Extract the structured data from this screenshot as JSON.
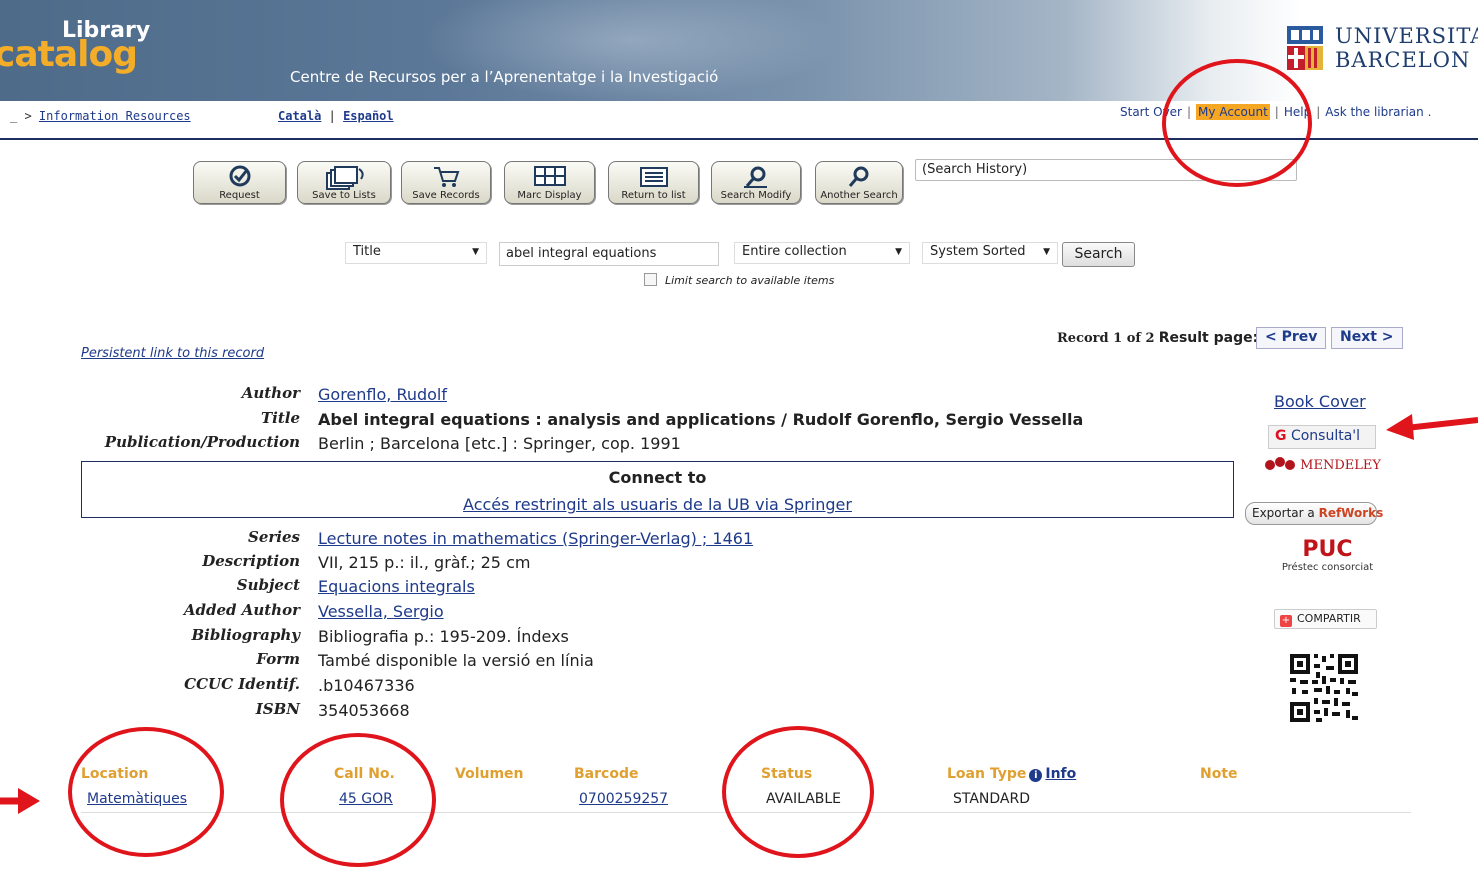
{
  "banner": {
    "logo_line1": "Library",
    "logo_line2": "catalog",
    "subtitle": "Centre de Recursos per a l’Aprenentatge i la Investigació",
    "university_line1": "UNIVERSITAT",
    "university_line2": "BARCELON"
  },
  "nav": {
    "breadcrumb_prefix": "_ >",
    "breadcrumb_link": "Information Resources",
    "lang_catala": "Català",
    "lang_sep": "|",
    "lang_espanol": "Español",
    "start_over": "Start Over",
    "my_account": "My Account",
    "help": "Help",
    "ask_librarian": "Ask the librarian ."
  },
  "toolbar": {
    "request": "Request",
    "save_to_lists": "Save to Lists",
    "save_records": "Save Records",
    "marc_display": "Marc Display",
    "return_to_list": "Return to list",
    "search_modify": "Search Modify",
    "another_search": "Another Search",
    "search_history": "(Search History)"
  },
  "search": {
    "field_type": "Title",
    "query": "abel integral equations",
    "scope": "Entire collection",
    "sort": "System Sorted",
    "button": "Search",
    "limit_label": "Limit search to available items"
  },
  "record_nav": {
    "record_text": "Record 1 of 2",
    "result_page": "Result page:",
    "prev": "< Prev",
    "next": "Next >",
    "persistent_link": "Persistent link to this record"
  },
  "record": {
    "author_label": "Author",
    "author": "Gorenflo, Rudolf",
    "title_label": "Title",
    "title": "Abel integral equations : analysis and applications / Rudolf Gorenflo, Sergio Vessella",
    "pub_label": "Publication/Production",
    "pub": "Berlin ; Barcelona [etc.] : Springer, cop. 1991",
    "connect_title": "Connect to",
    "connect_link": "Accés restringit als usuaris de la UB via Springer",
    "series_label": "Series",
    "series": "Lecture notes in mathematics (Springer-Verlag) ; 1461",
    "desc_label": "Description",
    "desc": "VII, 215 p.: il., gràf.; 25 cm",
    "subject_label": "Subject",
    "subject": "Equacions integrals",
    "added_author_label": "Added Author",
    "added_author": "Vessella, Sergio",
    "biblio_label": "Bibliography",
    "biblio": "Bibliografia p.: 195-209. Índexs",
    "form_label": "Form",
    "form": "També disponible la versió en línia",
    "ccuc_label": "CCUC Identif.",
    "ccuc": ".b10467336",
    "isbn_label": "ISBN",
    "isbn": "354053668"
  },
  "side": {
    "book_cover": "Book Cover",
    "consulta": "Consulta'l",
    "mendeley": "MENDELEY",
    "refworks_prefix": "Exportar a",
    "refworks": "RefWorks",
    "puc": "PUC",
    "puc_sub": "Préstec consorciat",
    "compartir": "COMPARTIR"
  },
  "holdings": {
    "headers": {
      "location": "Location",
      "call_no": "Call No.",
      "volumen": "Volumen",
      "barcode": "Barcode",
      "status": "Status",
      "loan_type": "Loan Type",
      "info": "Info",
      "note": "Note"
    },
    "row": {
      "location": "Matemàtiques",
      "call_no": "45 GOR",
      "barcode": "0700259257",
      "status": "AVAILABLE",
      "loan_type": "STANDARD"
    }
  },
  "colors": {
    "annotation": "#e0141b",
    "link": "#1e3a8a",
    "header_accent": "#e0a030",
    "my_account_bg": "#f5a623"
  }
}
